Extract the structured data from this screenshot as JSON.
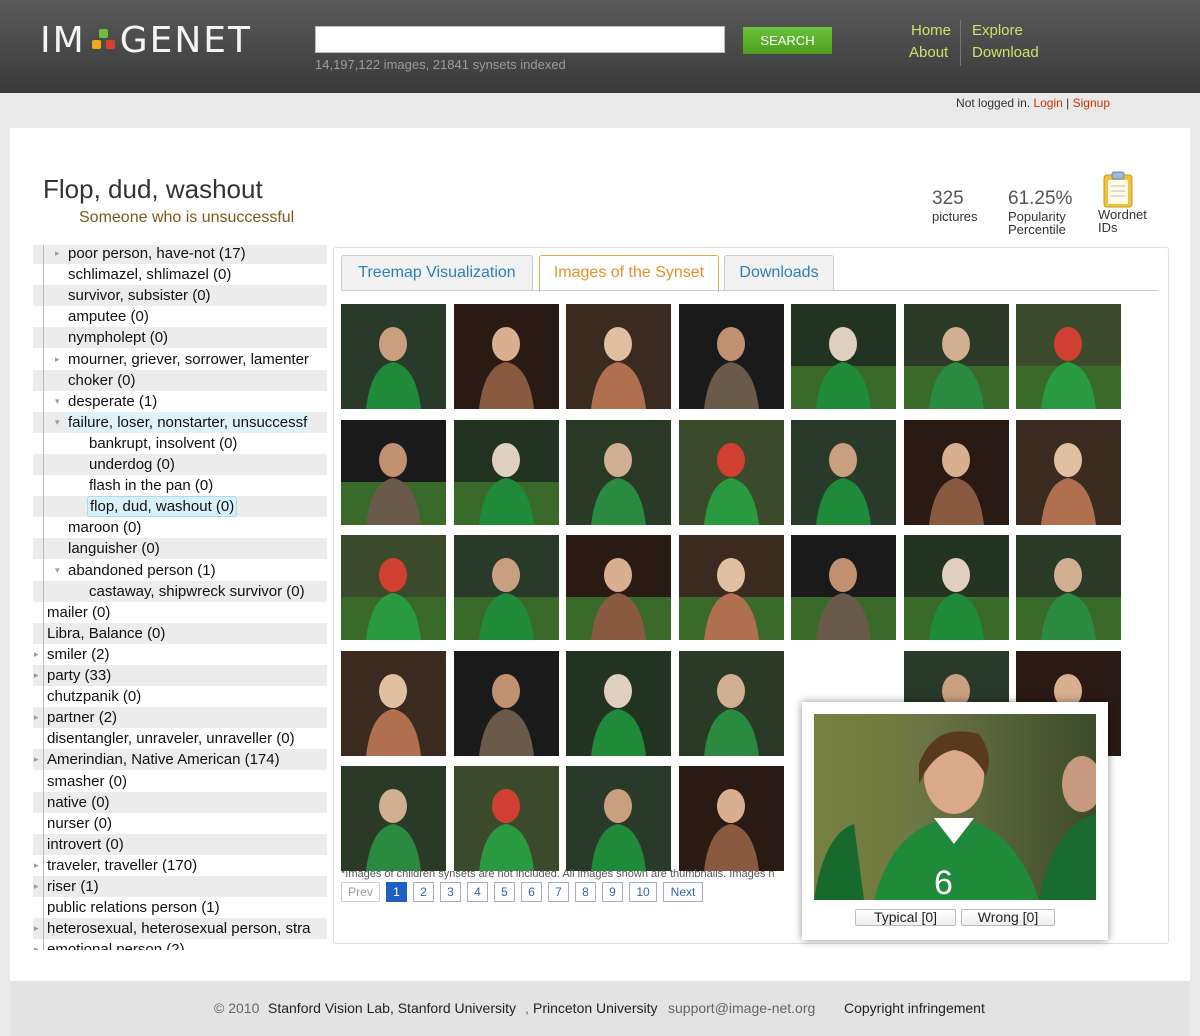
{
  "header": {
    "logo_text_left": "IM",
    "logo_text_right": "GENET",
    "search_placeholder": "",
    "search_button": "SEARCH",
    "index_stats": "14,197,122 images, 21841 synsets indexed",
    "nav": {
      "home": "Home",
      "about": "About",
      "explore": "Explore",
      "download": "Download"
    }
  },
  "auth": {
    "status": "Not logged in.",
    "login": "Login",
    "separator": "|",
    "signup": "Signup"
  },
  "synset": {
    "title": "Flop, dud, washout",
    "gloss": "Someone who is unsuccessful",
    "pictures_count": "325",
    "pictures_label": "pictures",
    "popularity": "61.25%",
    "popularity_label_1": "Popularity",
    "popularity_label_2": "Percentile",
    "wordnet_label_1": "Wordnet",
    "wordnet_label_2": "IDs"
  },
  "tree": [
    {
      "label": "poor person, have-not (17)",
      "expand": true
    },
    {
      "label": "schlimazel, shlimazel (0)",
      "expand": false
    },
    {
      "label": "survivor, subsister (0)",
      "expand": false
    },
    {
      "label": "amputee (0)",
      "expand": false
    },
    {
      "label": "nympholept (0)",
      "expand": false
    },
    {
      "label": "mourner, griever, sorrower, lamenter",
      "expand": true
    },
    {
      "label": "choker (0)",
      "expand": false
    },
    {
      "label": "desperate (1)",
      "expand": true
    },
    {
      "label": "failure, loser, nonstarter, unsuccessf",
      "expand": true
    },
    {
      "label": "bankrupt, insolvent (0)",
      "expand": false
    },
    {
      "label": "underdog (0)",
      "expand": false
    },
    {
      "label": "flash in the pan (0)",
      "expand": false
    },
    {
      "label": "flop, dud, washout (0)",
      "expand": false
    },
    {
      "label": "maroon (0)",
      "expand": false
    },
    {
      "label": "languisher (0)",
      "expand": false
    },
    {
      "label": "abandoned person (1)",
      "expand": true
    },
    {
      "label": "castaway, shipwreck survivor (0)",
      "expand": false
    },
    {
      "label": "mailer (0)",
      "expand": false
    },
    {
      "label": "Libra, Balance (0)",
      "expand": false
    },
    {
      "label": "smiler (2)",
      "expand": true
    },
    {
      "label": "party (33)",
      "expand": true
    },
    {
      "label": "chutzpanik (0)",
      "expand": false
    },
    {
      "label": "partner (2)",
      "expand": true
    },
    {
      "label": "disentangler, unraveler, unraveller (0)",
      "expand": false
    },
    {
      "label": "Amerindian, Native American (174)",
      "expand": true
    },
    {
      "label": "smasher (0)",
      "expand": false
    },
    {
      "label": "native (0)",
      "expand": false
    },
    {
      "label": "nurser (0)",
      "expand": false
    },
    {
      "label": "introvert (0)",
      "expand": false
    },
    {
      "label": "traveler, traveller (170)",
      "expand": true
    },
    {
      "label": "riser (1)",
      "expand": true
    },
    {
      "label": "public relations person (1)",
      "expand": false
    },
    {
      "label": "heterosexual, heterosexual person, stra",
      "expand": true
    },
    {
      "label": "emotional person (2)",
      "expand": true
    }
  ],
  "tabs": [
    "Treemap Visualization",
    "Images of the Synset",
    "Downloads"
  ],
  "active_tab": 1,
  "gallery": {
    "rows": 5,
    "cols": 7,
    "footnote": "*Images of children synsets are not included. All images shown are thumbnails. Images n",
    "pagination": {
      "prev": "Prev",
      "next": "Next",
      "pages": [
        "1",
        "2",
        "3",
        "4",
        "5",
        "6",
        "7",
        "8",
        "9",
        "10"
      ],
      "current": "1"
    }
  },
  "popup": {
    "typical": "Typical [0]",
    "wrong": "Wrong [0]"
  },
  "footer": {
    "copyright_prefix": "© 2010",
    "lab": "Stanford Vision Lab, Stanford University",
    "sep": ",",
    "princeton": "Princeton University",
    "email": "support@image-net.org",
    "infringement": "Copyright infringement"
  },
  "colors": {
    "accent_green": "#5bb32c",
    "nav_link": "#c9e36a",
    "active_tab": "#e8902a",
    "tab_link": "#2b7fb8"
  }
}
